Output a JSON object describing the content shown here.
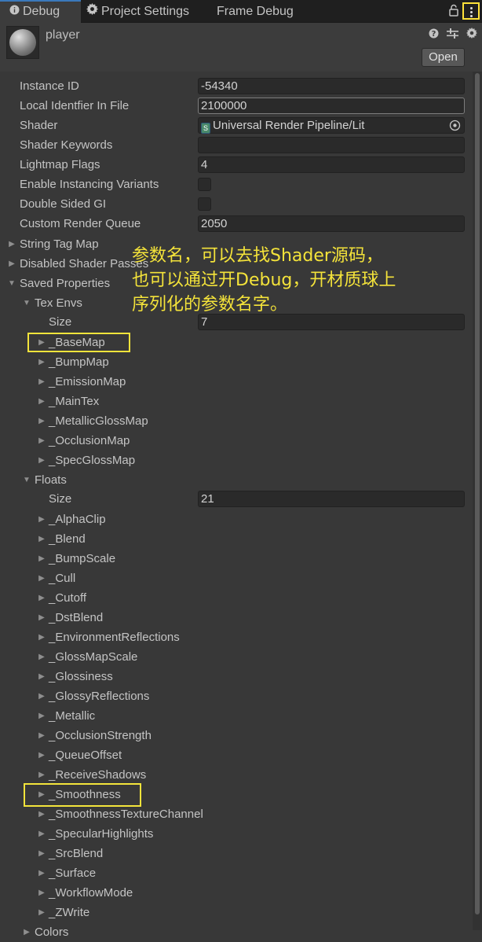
{
  "tabs": [
    {
      "label": "Debug",
      "active": true,
      "icon": "info-icon"
    },
    {
      "label": "Project Settings",
      "active": false,
      "icon": "gear-icon"
    },
    {
      "label": "Frame Debug",
      "active": false,
      "icon": ""
    }
  ],
  "header": {
    "object_name": "player",
    "open_label": "Open"
  },
  "properties": [
    {
      "label": "Instance ID",
      "value": "-54340",
      "kind": "field"
    },
    {
      "label": "Local Identfier In File",
      "value": "2100000",
      "kind": "field"
    },
    {
      "label": "Shader",
      "value": "Universal Render Pipeline/Lit",
      "kind": "shader"
    },
    {
      "label": "Shader Keywords",
      "value": "",
      "kind": "field"
    },
    {
      "label": "Lightmap Flags",
      "value": "4",
      "kind": "field"
    },
    {
      "label": "Enable Instancing Variants",
      "value": "",
      "kind": "checkbox"
    },
    {
      "label": "Double Sided GI",
      "value": "",
      "kind": "checkbox"
    },
    {
      "label": "Custom Render Queue",
      "value": "2050",
      "kind": "field"
    }
  ],
  "groups": {
    "string_tag_map": "String Tag Map",
    "disabled_shader_passes": "Disabled Shader Passes",
    "saved_properties": "Saved Properties",
    "tex_envs": "Tex Envs",
    "floats": "Floats",
    "colors": "Colors"
  },
  "tex_envs": {
    "size_label": "Size",
    "size_value": "7",
    "items": [
      "_BaseMap",
      "_BumpMap",
      "_EmissionMap",
      "_MainTex",
      "_MetallicGlossMap",
      "_OcclusionMap",
      "_SpecGlossMap"
    ]
  },
  "floats": {
    "size_label": "Size",
    "size_value": "21",
    "items": [
      "_AlphaClip",
      "_Blend",
      "_BumpScale",
      "_Cull",
      "_Cutoff",
      "_DstBlend",
      "_EnvironmentReflections",
      "_GlossMapScale",
      "_Glossiness",
      "_GlossyReflections",
      "_Metallic",
      "_OcclusionStrength",
      "_QueueOffset",
      "_ReceiveShadows",
      "_Smoothness",
      "_SmoothnessTextureChannel",
      "_SpecularHighlights",
      "_SrcBlend",
      "_Surface",
      "_WorkflowMode",
      "_ZWrite"
    ]
  },
  "annotation": {
    "line1": "参数名，可以去找Shader源码，",
    "line2": "也可以通过开Debug，开材质球上",
    "line3": "序列化的参数名字。"
  },
  "colors": {
    "highlight": "#f3e43b",
    "accent_tab": "#3a79bb"
  }
}
